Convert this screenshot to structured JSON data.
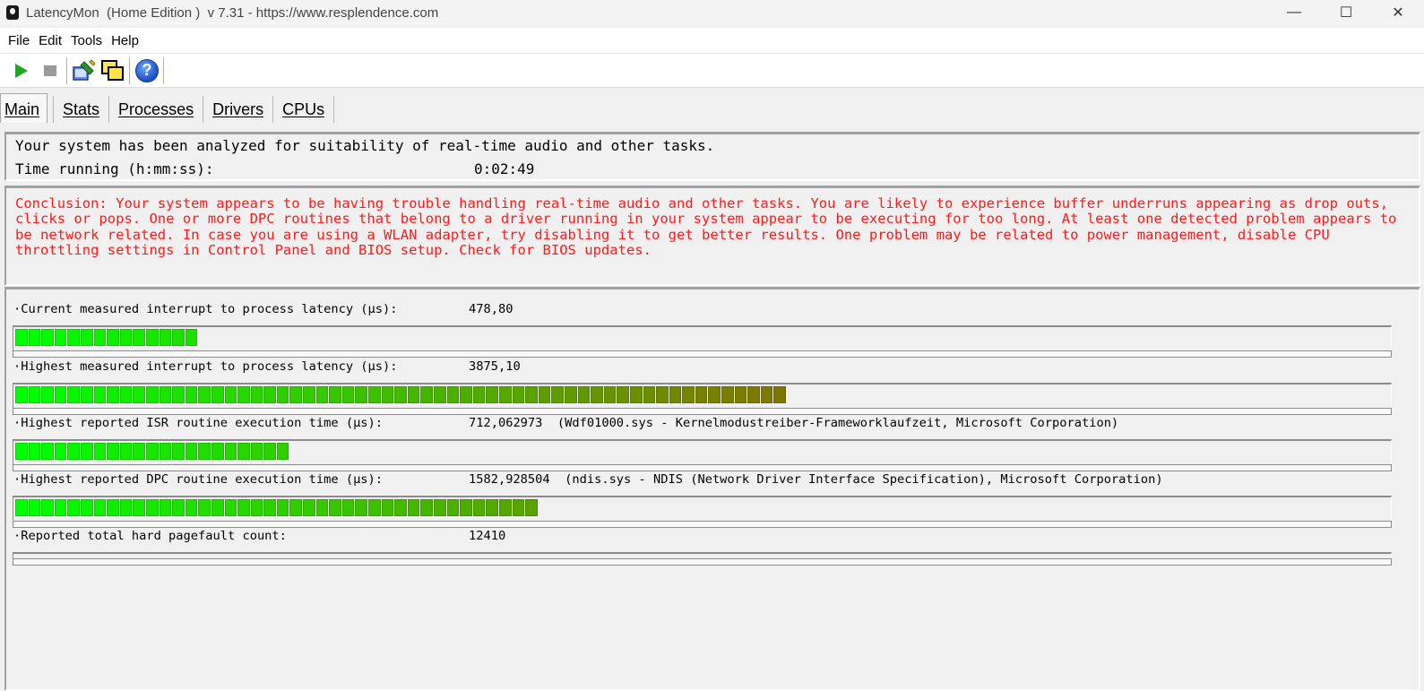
{
  "window": {
    "title": "LatencyMon  (Home Edition )  v 7.31 - https://www.resplendence.com",
    "minimize": "—",
    "maximize": "☐",
    "close": "✕"
  },
  "menu": {
    "items": [
      {
        "label": "File"
      },
      {
        "label": "Edit"
      },
      {
        "label": "Tools"
      },
      {
        "label": "Help"
      }
    ]
  },
  "toolbar": {
    "buttons": [
      {
        "icon": "play-icon"
      },
      {
        "icon": "stop-icon"
      },
      {
        "icon": "analyze-icon"
      },
      {
        "icon": "windows-icon"
      },
      {
        "icon": "help-icon",
        "glyph": "?"
      }
    ]
  },
  "tabs": [
    {
      "label": "Main",
      "active": true
    },
    {
      "label": "Stats"
    },
    {
      "label": "Processes"
    },
    {
      "label": "Drivers"
    },
    {
      "label": "CPUs"
    }
  ],
  "summary": {
    "analyzed_text": "Your system has been analyzed for suitability of real-time audio and other tasks.",
    "time_label": "Time running (h:mm:ss):",
    "time_value": "0:02:49"
  },
  "conclusion": "Conclusion: Your system appears to be having trouble handling real-time audio and other tasks. You are likely to experience buffer underruns appearing as drop outs, clicks or pops. One or more DPC routines that belong to a driver running in your system appear to be executing for too long. At least one detected problem appears to be network related. In case you are using a WLAN adapter, try disabling it to get better results. One problem may be related to power management, disable CPU throttling settings in Control Panel and BIOS setup. Check for BIOS updates.",
  "colors": {
    "conclusion_text": "#ff1a1a",
    "bar_green": "#00ff00",
    "bar_red": "#b41414"
  },
  "metrics": [
    {
      "label": "·Current measured interrupt to process latency (µs):",
      "value": "478,80",
      "fill_fraction": 0.134
    },
    {
      "label": "·Highest measured interrupt to process latency (µs):",
      "value": "3875,10",
      "fill_fraction": 0.566
    },
    {
      "label": "·Highest reported ISR routine execution time (µs):",
      "value": "712,062973  (Wdf01000.sys - Kernelmodustreiber-Frameworklaufzeit, Microsoft Corporation)",
      "fill_fraction": 0.201
    },
    {
      "label": "·Highest reported DPC routine execution time (µs):",
      "value": "1582,928504  (ndis.sys - NDIS (Network Driver Interface Specification), Microsoft Corporation)",
      "fill_fraction": 0.384
    },
    {
      "label": "·Reported total hard pagefault count:",
      "value": "12410",
      "fill_fraction": 0
    }
  ]
}
